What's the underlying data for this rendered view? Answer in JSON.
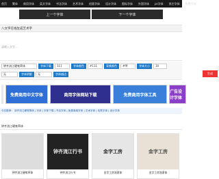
{
  "topnav": [
    "首页",
    "繁体",
    "商用字体",
    "英文字体",
    "书法字体",
    "艺术字体",
    "创意字体",
    "设计字体",
    "图标字体",
    "外国字体",
    "ps字体",
    "其它字体",
    "免费字体"
  ],
  "pager": {
    "prev": "上一个字体",
    "next": "下一个字体"
  },
  "title": "八文字在线生成艺术字",
  "textarea": {
    "placeholder": "请输入文字..."
  },
  "controls": {
    "row1": [
      "钟齐流江硬笔草体",
      "字体下载",
      "111",
      "字体颜色",
      "#111",
      "背景颜色",
      "#fff",
      "字体大小",
      "30"
    ],
    "row2": [
      "无",
      "字体阴影",
      "无",
      "字体描边"
    ],
    "generate": "生成"
  },
  "banners": [
    "免费商用中文字体",
    "商用字体网站下载",
    "免费商用字体工具",
    "广告设计字体"
  ],
  "tags": "今日推荐： 钟齐流江硬笔草体 | 字体 | 字体下载 | 书法字体 | 免费商用字体 | 艺术字体 | 毛笔字体 | 设计字体",
  "section": {
    "title": "钟齐流江硬笔草体"
  },
  "cards": [
    {
      "img": "",
      "caption": "钟齐流江硬笔草体"
    },
    {
      "img": "钟齐流江行书",
      "caption": "钟齐流江行书"
    },
    {
      "img": "金字工房",
      "caption": "金字工房流隶体"
    },
    {
      "img": "金字工房",
      "caption": "金字工房流隶体"
    }
  ]
}
